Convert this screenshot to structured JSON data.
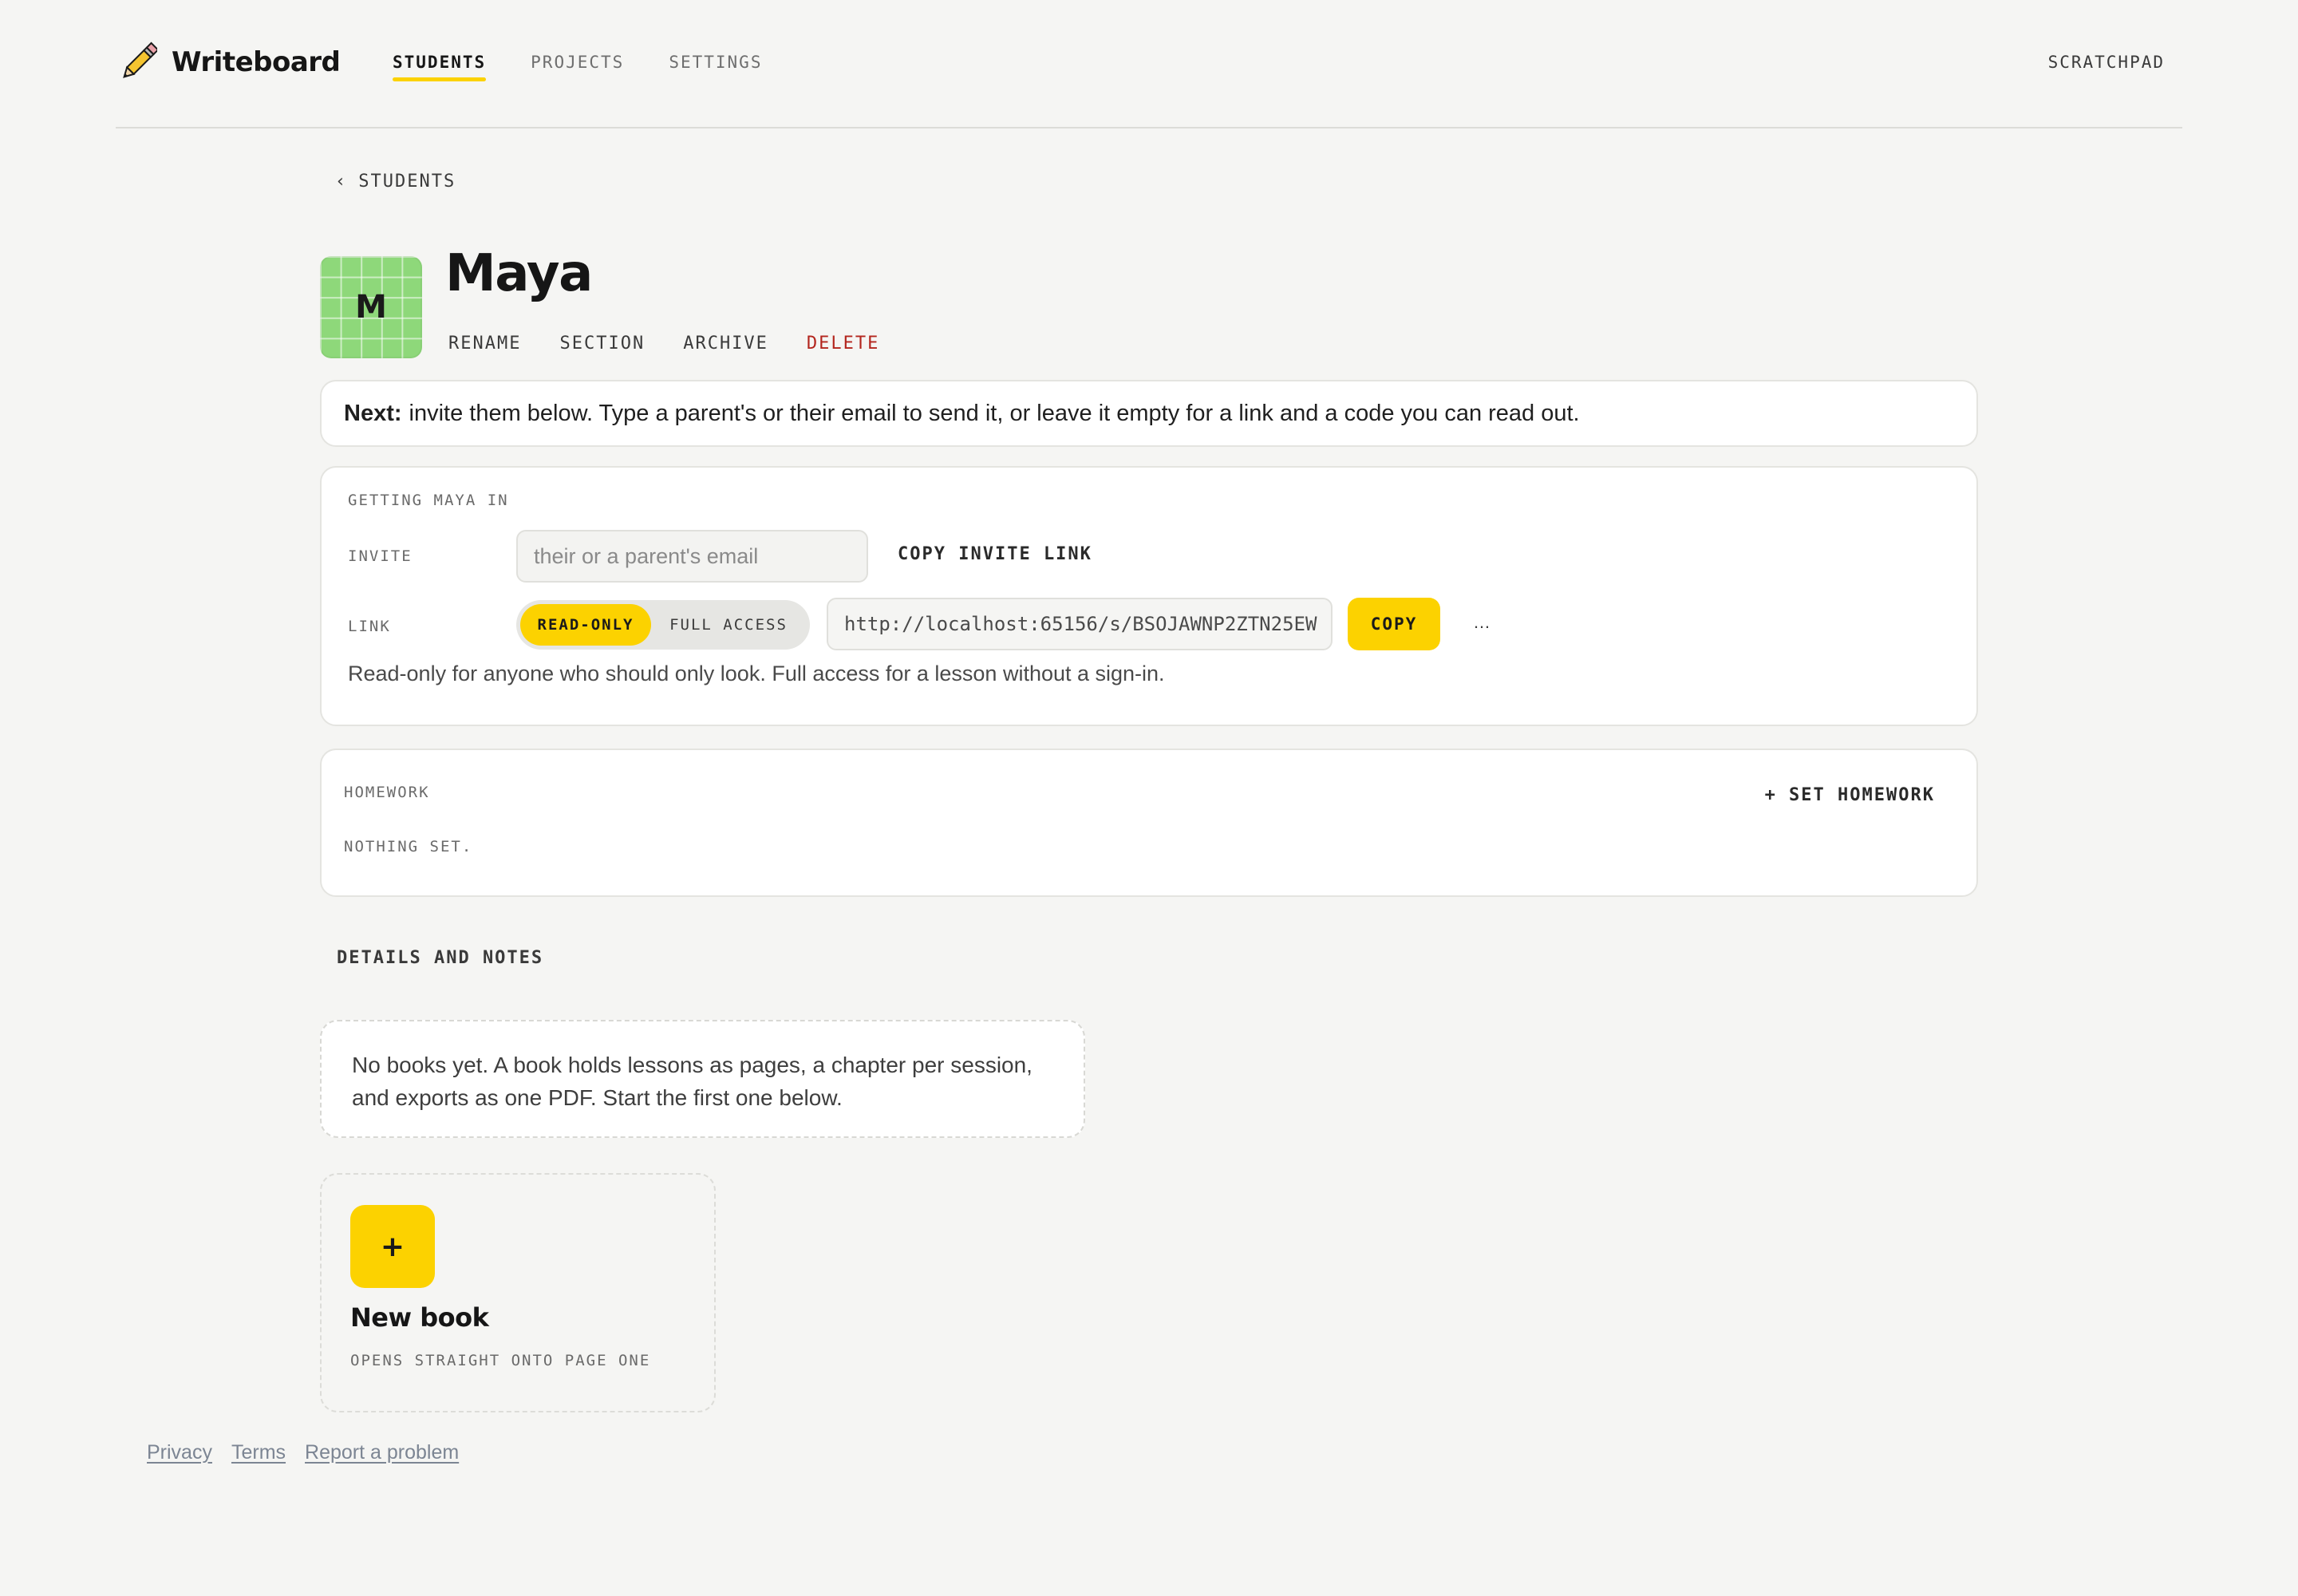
{
  "app": {
    "name": "Writeboard",
    "logo_icon": "pencil-icon"
  },
  "nav": {
    "items": [
      {
        "label": "STUDENTS",
        "active": true
      },
      {
        "label": "PROJECTS",
        "active": false
      },
      {
        "label": "SETTINGS",
        "active": false
      }
    ],
    "right_link": "SCRATCHPAD"
  },
  "back": {
    "chevron": "‹",
    "label": "STUDENTS"
  },
  "student": {
    "initial": "M",
    "name": "Maya",
    "avatar_color": "#8ed87a",
    "actions": [
      "RENAME",
      "SECTION",
      "ARCHIVE",
      "DELETE"
    ]
  },
  "next_tip": {
    "lead": "Next:",
    "text": "invite them below. Type a parent's or their email to send it, or leave it empty for a link and a code you can read out."
  },
  "invite": {
    "heading": "GETTING MAYA IN",
    "invite_label": "INVITE",
    "email_placeholder": "their or a parent's email",
    "email_value": "",
    "copy_invite_link": "COPY INVITE LINK",
    "link_label": "LINK",
    "access_options": [
      {
        "label": "READ-ONLY",
        "selected": true
      },
      {
        "label": "FULL ACCESS",
        "selected": false
      }
    ],
    "link_url": "http://localhost:65156/s/BSOJAWNP2ZTN25EW",
    "copy_button": "COPY",
    "more_button": "…",
    "help": "Read-only for anyone who should only look. Full access for a lesson without a sign-in."
  },
  "homework": {
    "heading": "HOMEWORK",
    "set_button": "+ SET HOMEWORK",
    "empty": "NOTHING SET."
  },
  "details": {
    "title": "DETAILS AND NOTES",
    "empty_books": "No books yet. A book holds lessons as pages, a chapter per session, and exports as one PDF. Start the first one below."
  },
  "new_book": {
    "plus": "+",
    "title": "New book",
    "subtitle": "OPENS STRAIGHT ONTO PAGE ONE"
  },
  "footer": {
    "links": [
      "Privacy",
      "Terms",
      "Report a problem"
    ]
  },
  "colors": {
    "accent": "#fcd200",
    "danger": "#b3261e",
    "background": "#f5f5f3"
  }
}
